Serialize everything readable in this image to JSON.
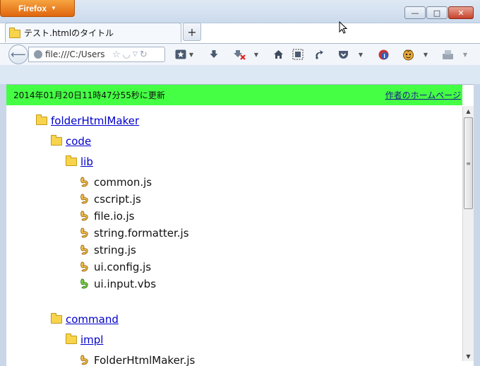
{
  "window": {
    "app_button_label": "Firefox",
    "controls": {
      "minimize": "—",
      "maximize": "□",
      "close": "✕"
    }
  },
  "tabs": [
    {
      "label": "テスト.htmlのタイトル",
      "icon": "folder-icon",
      "active": true
    }
  ],
  "new_tab_label": "+",
  "navbar": {
    "back_icon": "back-arrow-icon",
    "url": "file:///C:/Users",
    "toolbar_icons": [
      "bookmarks-icon",
      "downloads-icon",
      "addon-blocked-icon",
      "home-icon",
      "screenshot-icon",
      "sync-icon",
      "pocket-icon",
      "addon-info-icon",
      "avatar-icon",
      "plugin-icon"
    ]
  },
  "page": {
    "updated_text": "2014年01月20日11時47分55秒に更新",
    "author_link": "作者のホームページ",
    "header_color": "#44ff44",
    "tree": {
      "root": {
        "label": "folderHtmlMaker"
      },
      "code": {
        "label": "code"
      },
      "lib": {
        "label": "lib",
        "files": [
          "common.js",
          "cscript.js",
          "file.io.js",
          "string.formatter.js",
          "string.js",
          "ui.config.js",
          "ui.input.vbs"
        ]
      },
      "command": {
        "label": "command"
      },
      "impl": {
        "label": "impl"
      },
      "partial_file": "FolderHtmlMaker.js"
    }
  }
}
